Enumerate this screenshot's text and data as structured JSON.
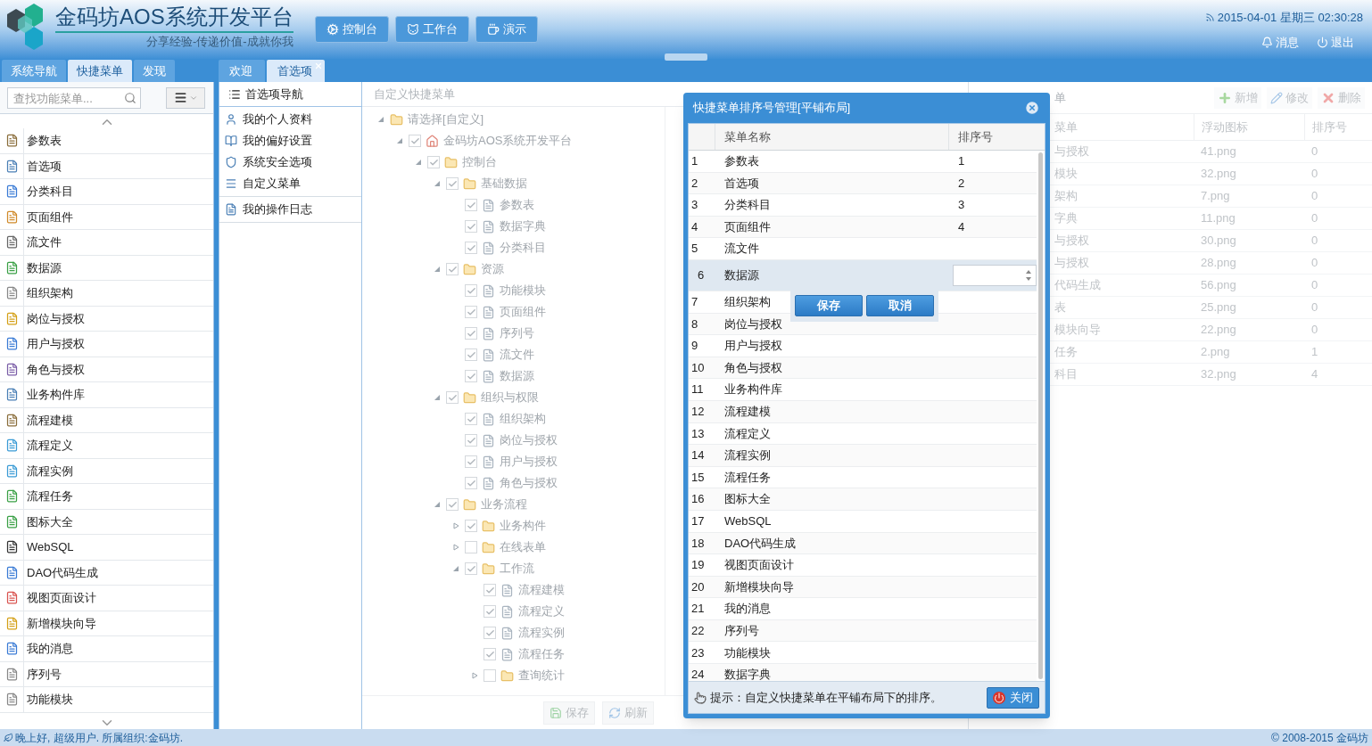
{
  "header": {
    "title": "金码坊AOS系统开发平台",
    "slogan": "分享经验-传递价值-成就你我",
    "nav_buttons": [
      "控制台",
      "工作台",
      "演示"
    ],
    "datetime": "2015-04-01 星期三 02:30:28",
    "links": [
      "消息",
      "退出"
    ]
  },
  "left_tabs": [
    {
      "label": "系统导航",
      "selected": false
    },
    {
      "label": "快捷菜单",
      "selected": true
    },
    {
      "label": "发现",
      "selected": false
    }
  ],
  "content_tabs": [
    {
      "label": "欢迎",
      "selected": false,
      "closable": false
    },
    {
      "label": "首选项",
      "selected": true,
      "closable": true
    }
  ],
  "sidebar": {
    "search_placeholder": "查找功能菜单...",
    "items": [
      "参数表",
      "首选项",
      "分类科目",
      "页面组件",
      "流文件",
      "数据源",
      "组织架构",
      "岗位与授权",
      "用户与授权",
      "角色与授权",
      "业务构件库",
      "流程建模",
      "流程定义",
      "流程实例",
      "流程任务",
      "图标大全",
      "WebSQL",
      "DAO代码生成",
      "视图页面设计",
      "新增模块向导",
      "我的消息",
      "序列号",
      "功能模块"
    ]
  },
  "pref_nav": {
    "title": "首选项导航",
    "groups": [
      [
        "我的个人资料",
        "我的偏好设置",
        "系统安全选项",
        "自定义菜单"
      ],
      [
        "我的操作日志"
      ]
    ]
  },
  "tree_panel": {
    "title": "自定义快捷菜单",
    "buttons": [
      "保存",
      "刷新"
    ],
    "tree": [
      {
        "label": "请选择[自定义]",
        "kind": "folder",
        "expanded": true,
        "children": [
          {
            "label": "金码坊AOS系统开发平台",
            "kind": "home",
            "checked": true,
            "expanded": true,
            "children": [
              {
                "label": "控制台",
                "kind": "folder",
                "checked": true,
                "expanded": true,
                "children": [
                  {
                    "label": "基础数据",
                    "kind": "folder",
                    "checked": true,
                    "expanded": true,
                    "children": [
                      {
                        "label": "参数表",
                        "kind": "item",
                        "checked": true
                      },
                      {
                        "label": "数据字典",
                        "kind": "item",
                        "checked": true
                      },
                      {
                        "label": "分类科目",
                        "kind": "item",
                        "checked": true
                      }
                    ]
                  },
                  {
                    "label": "资源",
                    "kind": "folder",
                    "checked": true,
                    "expanded": true,
                    "children": [
                      {
                        "label": "功能模块",
                        "kind": "item",
                        "checked": true
                      },
                      {
                        "label": "页面组件",
                        "kind": "item",
                        "checked": true
                      },
                      {
                        "label": "序列号",
                        "kind": "item",
                        "checked": true
                      },
                      {
                        "label": "流文件",
                        "kind": "item",
                        "checked": true
                      },
                      {
                        "label": "数据源",
                        "kind": "item",
                        "checked": true
                      }
                    ]
                  },
                  {
                    "label": "组织与权限",
                    "kind": "folder",
                    "checked": true,
                    "expanded": true,
                    "children": [
                      {
                        "label": "组织架构",
                        "kind": "item",
                        "checked": true
                      },
                      {
                        "label": "岗位与授权",
                        "kind": "item",
                        "checked": true
                      },
                      {
                        "label": "用户与授权",
                        "kind": "item",
                        "checked": true
                      },
                      {
                        "label": "角色与授权",
                        "kind": "item",
                        "checked": true
                      }
                    ]
                  },
                  {
                    "label": "业务流程",
                    "kind": "folder",
                    "checked": true,
                    "expanded": true,
                    "children": [
                      {
                        "label": "业务构件",
                        "kind": "folder",
                        "checked": true,
                        "expanded": false
                      },
                      {
                        "label": "在线表单",
                        "kind": "folder",
                        "checked": false,
                        "expanded": false
                      },
                      {
                        "label": "工作流",
                        "kind": "folder",
                        "checked": true,
                        "expanded": true,
                        "children": [
                          {
                            "label": "流程建模",
                            "kind": "item",
                            "checked": true
                          },
                          {
                            "label": "流程定义",
                            "kind": "item",
                            "checked": true
                          },
                          {
                            "label": "流程实例",
                            "kind": "item",
                            "checked": true
                          },
                          {
                            "label": "流程任务",
                            "kind": "item",
                            "checked": true
                          },
                          {
                            "label": "查询统计",
                            "kind": "folder",
                            "checked": false,
                            "expanded": false
                          }
                        ]
                      }
                    ]
                  }
                ]
              }
            ]
          }
        ]
      }
    ]
  },
  "right_panel": {
    "title": "单",
    "buttons": [
      "新增",
      "修改",
      "删除"
    ],
    "columns": [
      "菜单",
      "浮动图标",
      "排序号"
    ],
    "rows": [
      [
        "与授权",
        "41.png",
        "0"
      ],
      [
        "模块",
        "32.png",
        "0"
      ],
      [
        "架构",
        "7.png",
        "0"
      ],
      [
        "字典",
        "11.png",
        "0"
      ],
      [
        "与授权",
        "30.png",
        "0"
      ],
      [
        "与授权",
        "28.png",
        "0"
      ],
      [
        "代码生成",
        "56.png",
        "0"
      ],
      [
        "表",
        "25.png",
        "0"
      ],
      [
        "模块向导",
        "22.png",
        "0"
      ],
      [
        "任务",
        "2.png",
        "1"
      ],
      [
        "科目",
        "32.png",
        "4"
      ]
    ]
  },
  "modal": {
    "title": "快捷菜单排序号管理[平铺布局]",
    "columns": [
      "菜单名称",
      "排序号"
    ],
    "rows": [
      {
        "index": "1",
        "name": "参数表",
        "order": "1",
        "editing": false
      },
      {
        "index": "2",
        "name": "首选项",
        "order": "2",
        "editing": false
      },
      {
        "index": "3",
        "name": "分类科目",
        "order": "3",
        "editing": false
      },
      {
        "index": "4",
        "name": "页面组件",
        "order": "4",
        "editing": false
      },
      {
        "index": "5",
        "name": "流文件",
        "editing": false
      },
      {
        "index": "6",
        "name": "数据源",
        "editing": true
      },
      {
        "index": "7",
        "name": "组织架构",
        "editing": false
      },
      {
        "index": "8",
        "name": "岗位与授权",
        "editing": false
      },
      {
        "index": "9",
        "name": "用户与授权",
        "editing": false
      },
      {
        "index": "10",
        "name": "角色与授权",
        "editing": false
      },
      {
        "index": "11",
        "name": "业务构件库",
        "editing": false
      },
      {
        "index": "12",
        "name": "流程建模",
        "editing": false
      },
      {
        "index": "13",
        "name": "流程定义",
        "editing": false
      },
      {
        "index": "14",
        "name": "流程实例",
        "editing": false
      },
      {
        "index": "15",
        "name": "流程任务",
        "editing": false
      },
      {
        "index": "16",
        "name": "图标大全",
        "editing": false
      },
      {
        "index": "17",
        "name": "WebSQL",
        "editing": false
      },
      {
        "index": "18",
        "name": "DAO代码生成",
        "editing": false
      },
      {
        "index": "19",
        "name": "视图页面设计",
        "editing": false
      },
      {
        "index": "20",
        "name": "新增模块向导",
        "editing": false
      },
      {
        "index": "21",
        "name": "我的消息",
        "editing": false
      },
      {
        "index": "22",
        "name": "序列号",
        "editing": false
      },
      {
        "index": "23",
        "name": "功能模块",
        "editing": false
      },
      {
        "index": "24",
        "name": "数据字典",
        "editing": false
      }
    ],
    "editor_buttons": [
      "保存",
      "取消"
    ],
    "hint": "提示：自定义快捷菜单在平铺布局下的排序。",
    "close_label": "关闭"
  },
  "status_bar": {
    "greeting": "晚上好, 超级用户. 所属组织:金码坊.",
    "copyright": "© 2008-2015 金码坊"
  }
}
